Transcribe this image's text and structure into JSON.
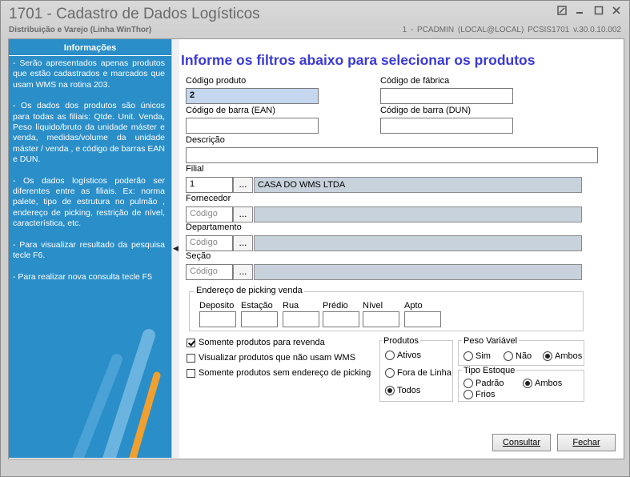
{
  "window": {
    "title": "1701 - Cadastro de Dados Logísticos",
    "subtitle": "Distribuição e Varejo (Linha WinThor)",
    "user_info": "1 - PCADMIN (LOCAL@LOCAL)   PCSIS1701  v.30.0.10.002"
  },
  "sidebar": {
    "heading": "Informações",
    "paragraphs": [
      "- Serão apresentados apenas produtos que estão cadastrados e marcados que usam WMS na rotina 203.",
      "- Os dados dos produtos são únicos para todas as filiais: Qtde. Unit. Venda, Peso líquido/bruto da unidade máster e venda, medidas/volume da unidade máster / venda , e código de barras EAN e DUN.",
      "- Os dados logísticos poderão ser diferentes entre as filiais. Ex: norma palete, tipo de estrutura no pulmão , endereço de picking, restrição de nível, característica, etc.",
      "- Para visualizar resultado da pesquisa tecle F6.",
      "- Para realizar nova consulta tecle F5"
    ]
  },
  "form": {
    "heading": "Informe os filtros abaixo para selecionar os produtos",
    "codigo_produto": {
      "label": "Código produto",
      "value": "2"
    },
    "codigo_fabrica": {
      "label": "Código de fábrica",
      "value": ""
    },
    "codigo_ean": {
      "label": "Código de barra (EAN)",
      "value": ""
    },
    "codigo_dun": {
      "label": "Código de barra (DUN)",
      "value": ""
    },
    "descricao": {
      "label": "Descrição",
      "value": ""
    },
    "filial": {
      "label": "Filial",
      "code": "1",
      "name": "CASA DO WMS LTDA"
    },
    "fornecedor": {
      "label": "Fornecedor",
      "placeholder": "Código",
      "name": ""
    },
    "departamento": {
      "label": "Departamento",
      "placeholder": "Código",
      "name": ""
    },
    "secao": {
      "label": "Seção",
      "placeholder": "Código",
      "name": ""
    },
    "lookup_button": "...",
    "picking": {
      "title": "Endereço de picking venda",
      "fields": [
        "Deposito",
        "Estação",
        "Rua",
        "Prédio",
        "Nível",
        "Apto"
      ]
    },
    "checkboxes": [
      {
        "label": "Somente produtos para revenda",
        "checked": true
      },
      {
        "label": "Visualizar produtos que não usam WMS",
        "checked": false
      },
      {
        "label": "Somente produtos sem endereço de picking",
        "checked": false
      }
    ],
    "produtos": {
      "title": "Produtos",
      "options": [
        {
          "label": "Ativos",
          "selected": false
        },
        {
          "label": "Fora de Linha",
          "selected": false
        },
        {
          "label": "Todos",
          "selected": true
        }
      ]
    },
    "peso_variavel": {
      "title": "Peso Variável",
      "options": [
        {
          "label": "Sim",
          "selected": false
        },
        {
          "label": "Não",
          "selected": false
        },
        {
          "label": "Ambos",
          "selected": true
        }
      ]
    },
    "tipo_estoque": {
      "title": "Tipo Estoque",
      "options": [
        {
          "label": "Padrão",
          "selected": false
        },
        {
          "label": "Ambos",
          "selected": true
        },
        {
          "label": "Frios",
          "selected": false
        }
      ]
    },
    "buttons": {
      "consultar": "Consultar",
      "fechar": "Fechar"
    }
  }
}
